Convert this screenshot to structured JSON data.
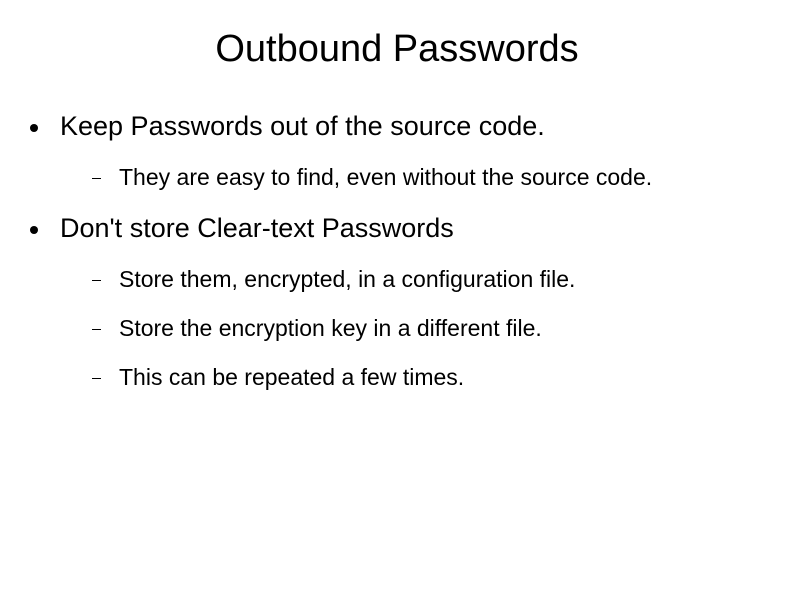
{
  "title": "Outbound Passwords",
  "bullets": [
    {
      "text": "Keep Passwords out of the source code.",
      "subs": [
        "They are easy to find, even without the source code."
      ]
    },
    {
      "text": "Don't store Clear-text Passwords",
      "subs": [
        "Store them, encrypted, in a configuration file.",
        "Store the encryption key in a different file.",
        "This can be repeated a few times."
      ]
    }
  ]
}
